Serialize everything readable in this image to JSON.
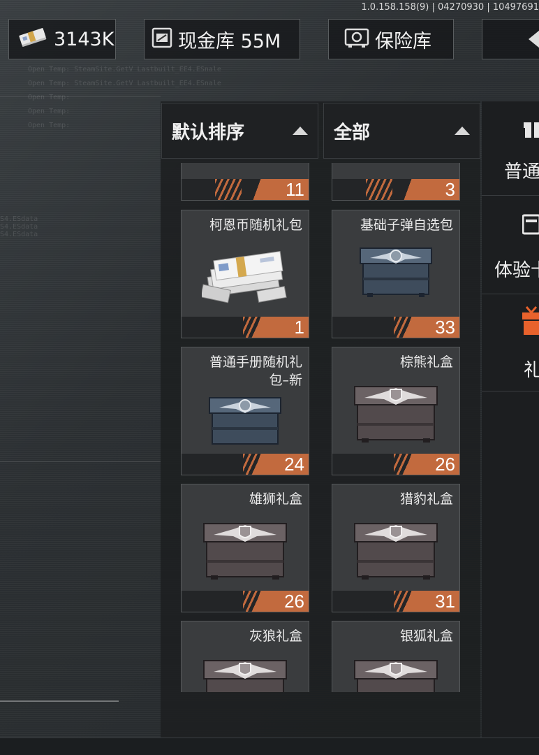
{
  "version": "1.0.158.158(9) | 04270930 | 10497691",
  "currency": {
    "money_value": "3143K",
    "cash_label": "现金库 55M",
    "safe_label": "保险库"
  },
  "bg_code_lines": [
    "Open Temp: SteamSite.GetV Lastbuilt_EE4.ESnale",
    "Open Temp: SteamSite.GetV Lastbuilt_EE4.ESnale",
    "Open Temp:",
    "Open Temp:",
    "Open Temp:"
  ],
  "bg_code_side": [
    "S4.ESdata",
    "S4.ESdata",
    "S4.ESdata"
  ],
  "filters": {
    "sort_label": "默认排序",
    "category_label": "全部"
  },
  "items": [
    {
      "name": "",
      "count": "11",
      "art": "none"
    },
    {
      "name": "",
      "count": "3",
      "art": "none"
    },
    {
      "name": "柯恩币随机礼包",
      "count": "1",
      "art": "money"
    },
    {
      "name": "基础子弹自选包",
      "count": "33",
      "art": "blue-crate"
    },
    {
      "name": "普通手册随机礼包–新",
      "count": "24",
      "art": "blue-crate"
    },
    {
      "name": "棕熊礼盒",
      "count": "26",
      "art": "grey-crate"
    },
    {
      "name": "雄狮礼盒",
      "count": "26",
      "art": "grey-crate"
    },
    {
      "name": "猎豹礼盒",
      "count": "31",
      "art": "grey-crate"
    },
    {
      "name": "灰狼礼盒",
      "count": "",
      "art": "grey-crate"
    },
    {
      "name": "银狐礼盒",
      "count": "",
      "art": "grey-crate"
    }
  ],
  "side_tabs": [
    {
      "label": "普通",
      "icon": "gift-icon"
    },
    {
      "label": "体验卡",
      "icon": "card-icon"
    },
    {
      "label": "礼",
      "icon": "gift-orange-icon"
    }
  ],
  "colors": {
    "accent_orange": "#c26a3e",
    "gift_orange": "#e8622c"
  }
}
